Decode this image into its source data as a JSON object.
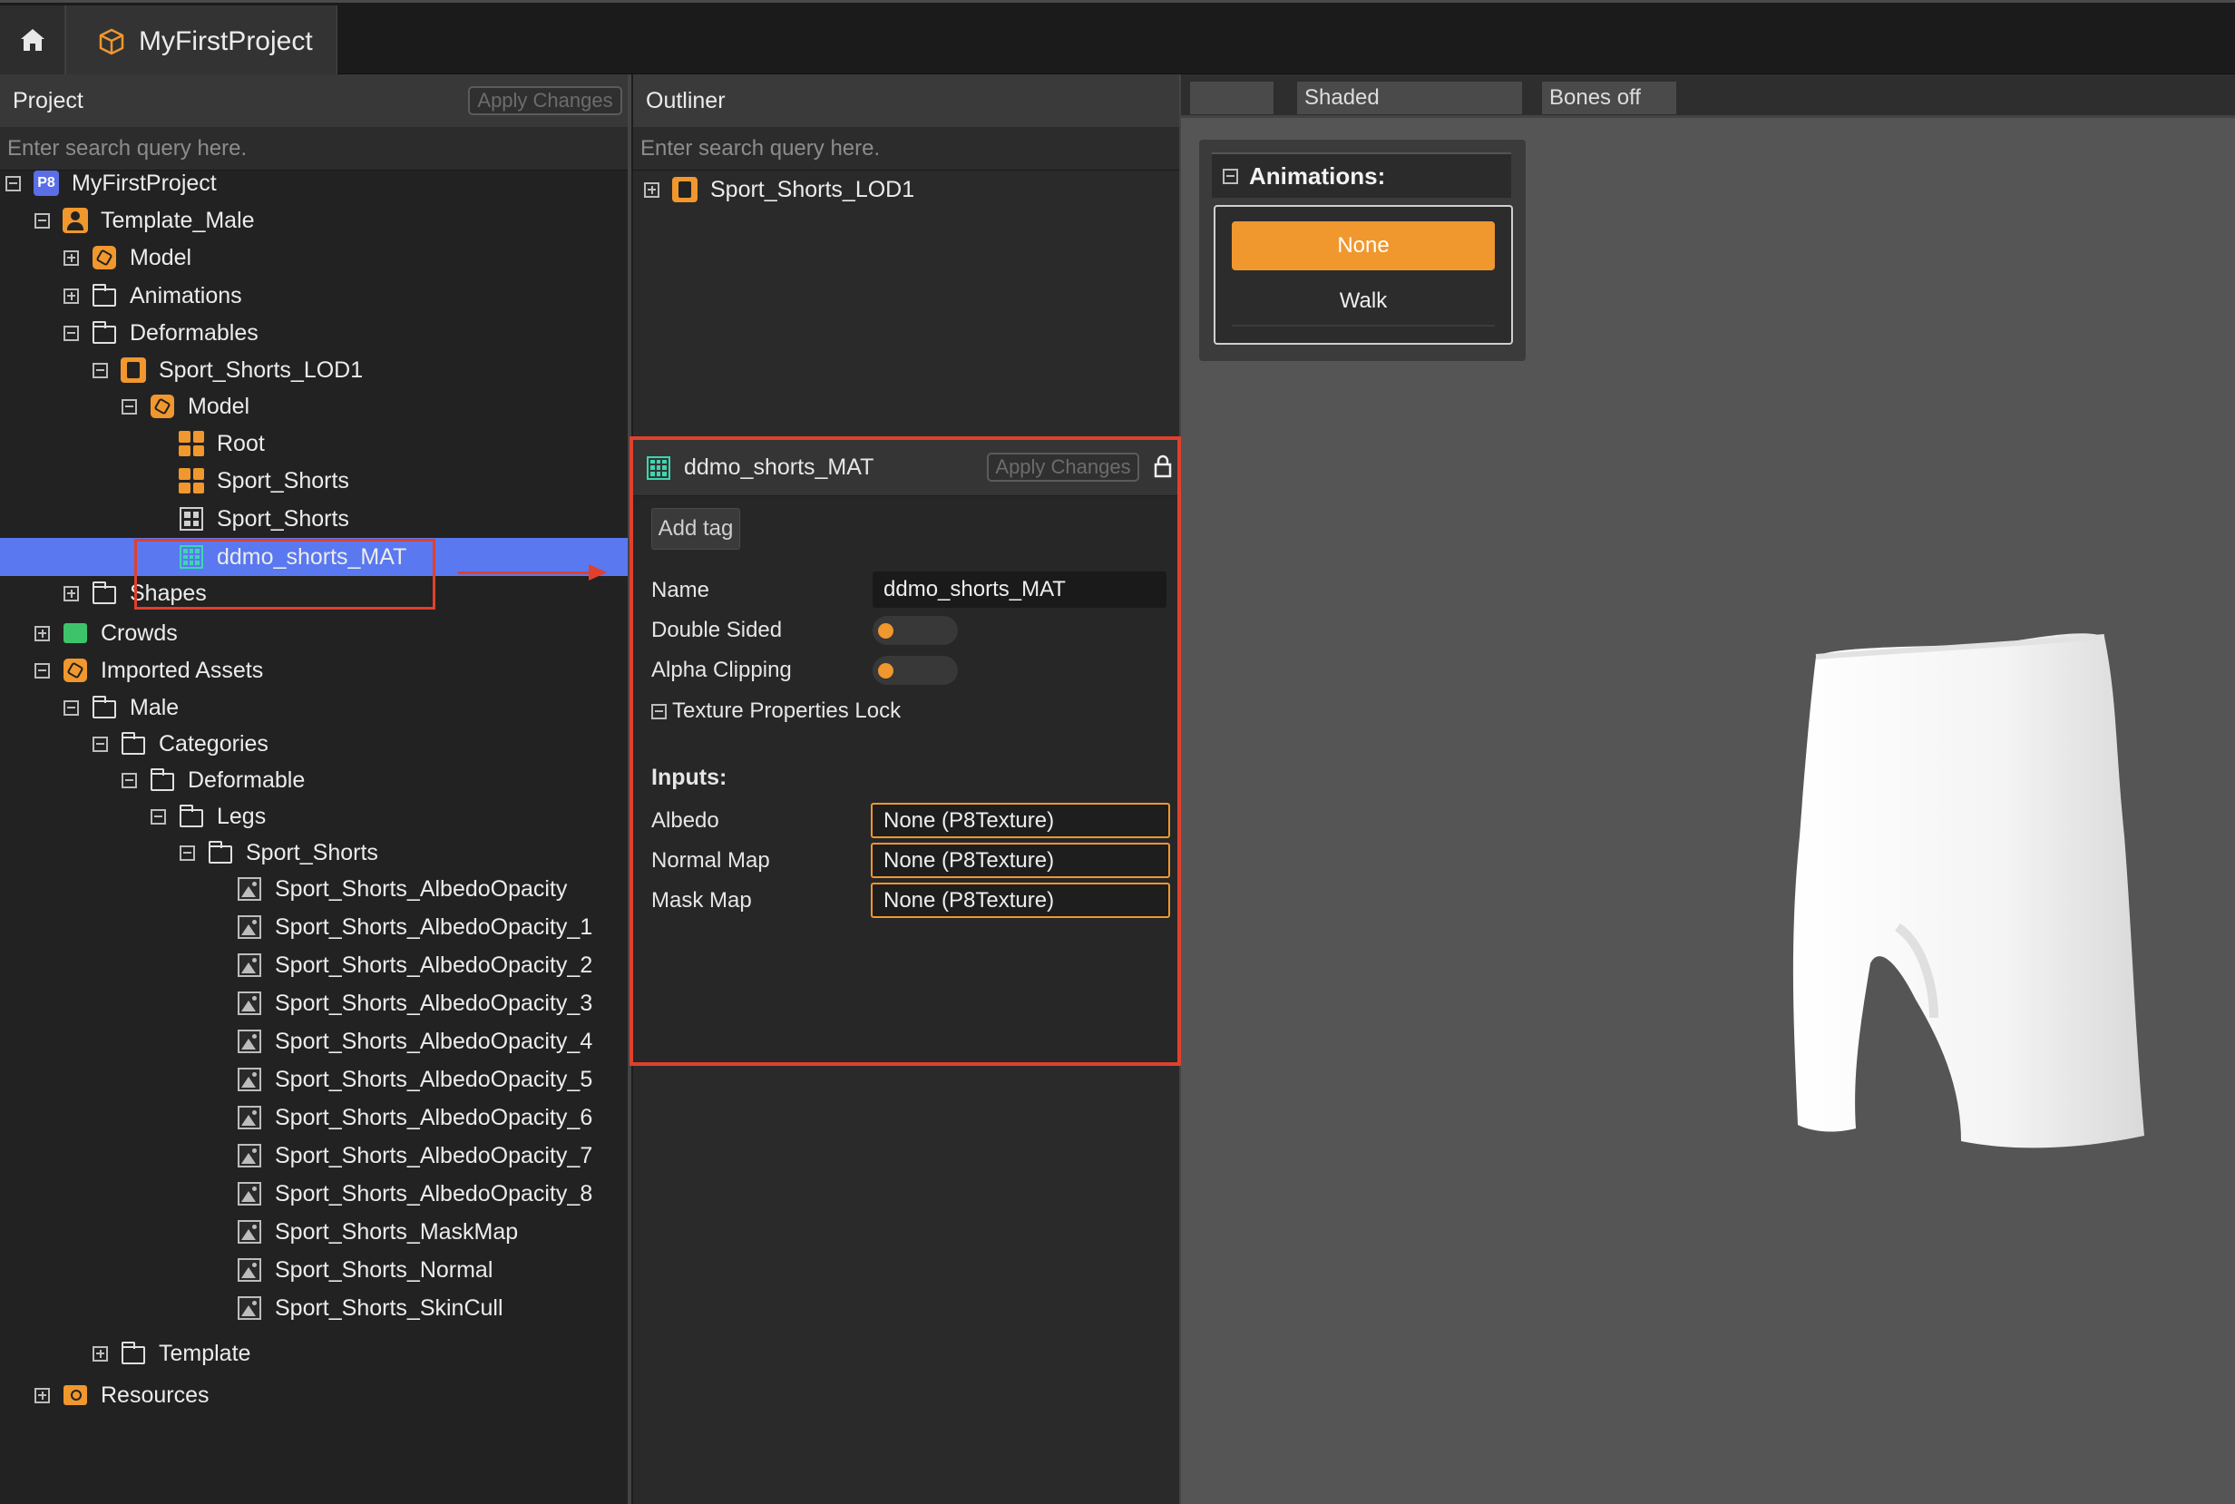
{
  "window": {
    "tab_title": "MyFirstProject"
  },
  "project_panel": {
    "title": "Project",
    "apply_label": "Apply Changes",
    "search_placeholder": "Enter search query here.",
    "tree": [
      {
        "label": "MyFirstProject"
      },
      {
        "label": "Template_Male"
      },
      {
        "label": "Model"
      },
      {
        "label": "Animations"
      },
      {
        "label": "Deformables"
      },
      {
        "label": "Sport_Shorts_LOD1"
      },
      {
        "label": "Model"
      },
      {
        "label": "Root"
      },
      {
        "label": "Sport_Shorts"
      },
      {
        "label": "Sport_Shorts"
      },
      {
        "label": "ddmo_shorts_MAT"
      },
      {
        "label": "Shapes"
      },
      {
        "label": "Crowds"
      },
      {
        "label": "Imported Assets"
      },
      {
        "label": "Male"
      },
      {
        "label": "Categories"
      },
      {
        "label": "Deformable"
      },
      {
        "label": "Legs"
      },
      {
        "label": "Sport_Shorts"
      },
      {
        "label": "Sport_Shorts_AlbedoOpacity"
      },
      {
        "label": "Sport_Shorts_AlbedoOpacity_1"
      },
      {
        "label": "Sport_Shorts_AlbedoOpacity_2"
      },
      {
        "label": "Sport_Shorts_AlbedoOpacity_3"
      },
      {
        "label": "Sport_Shorts_AlbedoOpacity_4"
      },
      {
        "label": "Sport_Shorts_AlbedoOpacity_5"
      },
      {
        "label": "Sport_Shorts_AlbedoOpacity_6"
      },
      {
        "label": "Sport_Shorts_AlbedoOpacity_7"
      },
      {
        "label": "Sport_Shorts_AlbedoOpacity_8"
      },
      {
        "label": "Sport_Shorts_MaskMap"
      },
      {
        "label": "Sport_Shorts_Normal"
      },
      {
        "label": "Sport_Shorts_SkinCull"
      },
      {
        "label": "Template"
      },
      {
        "label": "Resources"
      }
    ]
  },
  "outliner": {
    "title": "Outliner",
    "search_placeholder": "Enter search query here.",
    "items": [
      {
        "label": "Sport_Shorts_LOD1"
      }
    ]
  },
  "material": {
    "title": "ddmo_shorts_MAT",
    "apply_label": "Apply Changes",
    "add_tag_label": "Add tag",
    "name_label": "Name",
    "name_value": "ddmo_shorts_MAT",
    "double_sided_label": "Double Sided",
    "alpha_clipping_label": "Alpha Clipping",
    "texture_lock_label": "Texture Properties Lock",
    "inputs_heading": "Inputs:",
    "inputs": [
      {
        "label": "Albedo",
        "value": "None (P8Texture)"
      },
      {
        "label": "Normal Map",
        "value": "None (P8Texture)"
      },
      {
        "label": "Mask Map",
        "value": "None (P8Texture)"
      }
    ]
  },
  "viewport": {
    "shading_label": "Shaded",
    "bones_label": "Bones off",
    "animations_title": "Animations:",
    "animations": [
      {
        "label": "None"
      },
      {
        "label": "Walk"
      }
    ]
  },
  "colors": {
    "accent": "#f0972e",
    "selection": "#5a78f0",
    "highlight": "#e0402c"
  }
}
